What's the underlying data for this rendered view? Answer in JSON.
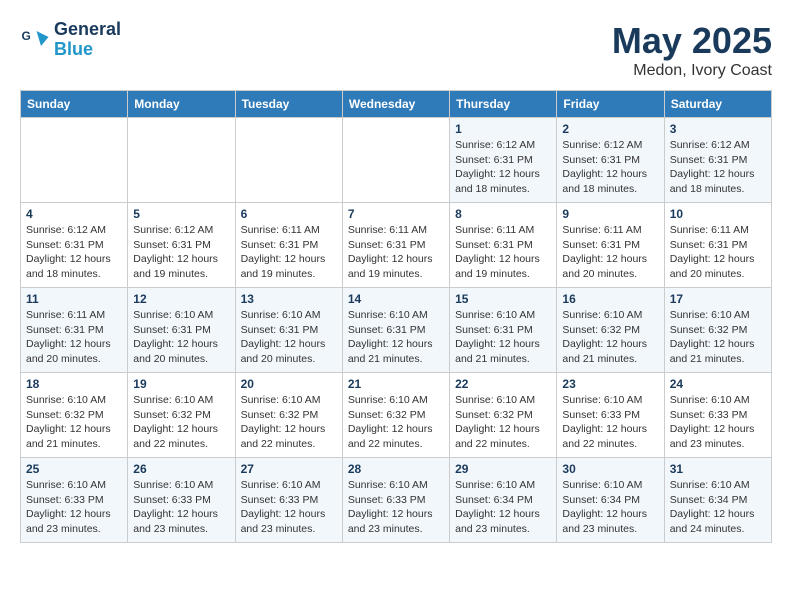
{
  "logo": {
    "line1": "General",
    "line2": "Blue"
  },
  "title": "May 2025",
  "location": "Medon, Ivory Coast",
  "days_of_week": [
    "Sunday",
    "Monday",
    "Tuesday",
    "Wednesday",
    "Thursday",
    "Friday",
    "Saturday"
  ],
  "weeks": [
    [
      {
        "num": "",
        "info": ""
      },
      {
        "num": "",
        "info": ""
      },
      {
        "num": "",
        "info": ""
      },
      {
        "num": "",
        "info": ""
      },
      {
        "num": "1",
        "info": "Sunrise: 6:12 AM\nSunset: 6:31 PM\nDaylight: 12 hours\nand 18 minutes."
      },
      {
        "num": "2",
        "info": "Sunrise: 6:12 AM\nSunset: 6:31 PM\nDaylight: 12 hours\nand 18 minutes."
      },
      {
        "num": "3",
        "info": "Sunrise: 6:12 AM\nSunset: 6:31 PM\nDaylight: 12 hours\nand 18 minutes."
      }
    ],
    [
      {
        "num": "4",
        "info": "Sunrise: 6:12 AM\nSunset: 6:31 PM\nDaylight: 12 hours\nand 18 minutes."
      },
      {
        "num": "5",
        "info": "Sunrise: 6:12 AM\nSunset: 6:31 PM\nDaylight: 12 hours\nand 19 minutes."
      },
      {
        "num": "6",
        "info": "Sunrise: 6:11 AM\nSunset: 6:31 PM\nDaylight: 12 hours\nand 19 minutes."
      },
      {
        "num": "7",
        "info": "Sunrise: 6:11 AM\nSunset: 6:31 PM\nDaylight: 12 hours\nand 19 minutes."
      },
      {
        "num": "8",
        "info": "Sunrise: 6:11 AM\nSunset: 6:31 PM\nDaylight: 12 hours\nand 19 minutes."
      },
      {
        "num": "9",
        "info": "Sunrise: 6:11 AM\nSunset: 6:31 PM\nDaylight: 12 hours\nand 20 minutes."
      },
      {
        "num": "10",
        "info": "Sunrise: 6:11 AM\nSunset: 6:31 PM\nDaylight: 12 hours\nand 20 minutes."
      }
    ],
    [
      {
        "num": "11",
        "info": "Sunrise: 6:11 AM\nSunset: 6:31 PM\nDaylight: 12 hours\nand 20 minutes."
      },
      {
        "num": "12",
        "info": "Sunrise: 6:10 AM\nSunset: 6:31 PM\nDaylight: 12 hours\nand 20 minutes."
      },
      {
        "num": "13",
        "info": "Sunrise: 6:10 AM\nSunset: 6:31 PM\nDaylight: 12 hours\nand 20 minutes."
      },
      {
        "num": "14",
        "info": "Sunrise: 6:10 AM\nSunset: 6:31 PM\nDaylight: 12 hours\nand 21 minutes."
      },
      {
        "num": "15",
        "info": "Sunrise: 6:10 AM\nSunset: 6:31 PM\nDaylight: 12 hours\nand 21 minutes."
      },
      {
        "num": "16",
        "info": "Sunrise: 6:10 AM\nSunset: 6:32 PM\nDaylight: 12 hours\nand 21 minutes."
      },
      {
        "num": "17",
        "info": "Sunrise: 6:10 AM\nSunset: 6:32 PM\nDaylight: 12 hours\nand 21 minutes."
      }
    ],
    [
      {
        "num": "18",
        "info": "Sunrise: 6:10 AM\nSunset: 6:32 PM\nDaylight: 12 hours\nand 21 minutes."
      },
      {
        "num": "19",
        "info": "Sunrise: 6:10 AM\nSunset: 6:32 PM\nDaylight: 12 hours\nand 22 minutes."
      },
      {
        "num": "20",
        "info": "Sunrise: 6:10 AM\nSunset: 6:32 PM\nDaylight: 12 hours\nand 22 minutes."
      },
      {
        "num": "21",
        "info": "Sunrise: 6:10 AM\nSunset: 6:32 PM\nDaylight: 12 hours\nand 22 minutes."
      },
      {
        "num": "22",
        "info": "Sunrise: 6:10 AM\nSunset: 6:32 PM\nDaylight: 12 hours\nand 22 minutes."
      },
      {
        "num": "23",
        "info": "Sunrise: 6:10 AM\nSunset: 6:33 PM\nDaylight: 12 hours\nand 22 minutes."
      },
      {
        "num": "24",
        "info": "Sunrise: 6:10 AM\nSunset: 6:33 PM\nDaylight: 12 hours\nand 23 minutes."
      }
    ],
    [
      {
        "num": "25",
        "info": "Sunrise: 6:10 AM\nSunset: 6:33 PM\nDaylight: 12 hours\nand 23 minutes."
      },
      {
        "num": "26",
        "info": "Sunrise: 6:10 AM\nSunset: 6:33 PM\nDaylight: 12 hours\nand 23 minutes."
      },
      {
        "num": "27",
        "info": "Sunrise: 6:10 AM\nSunset: 6:33 PM\nDaylight: 12 hours\nand 23 minutes."
      },
      {
        "num": "28",
        "info": "Sunrise: 6:10 AM\nSunset: 6:33 PM\nDaylight: 12 hours\nand 23 minutes."
      },
      {
        "num": "29",
        "info": "Sunrise: 6:10 AM\nSunset: 6:34 PM\nDaylight: 12 hours\nand 23 minutes."
      },
      {
        "num": "30",
        "info": "Sunrise: 6:10 AM\nSunset: 6:34 PM\nDaylight: 12 hours\nand 23 minutes."
      },
      {
        "num": "31",
        "info": "Sunrise: 6:10 AM\nSunset: 6:34 PM\nDaylight: 12 hours\nand 24 minutes."
      }
    ]
  ]
}
